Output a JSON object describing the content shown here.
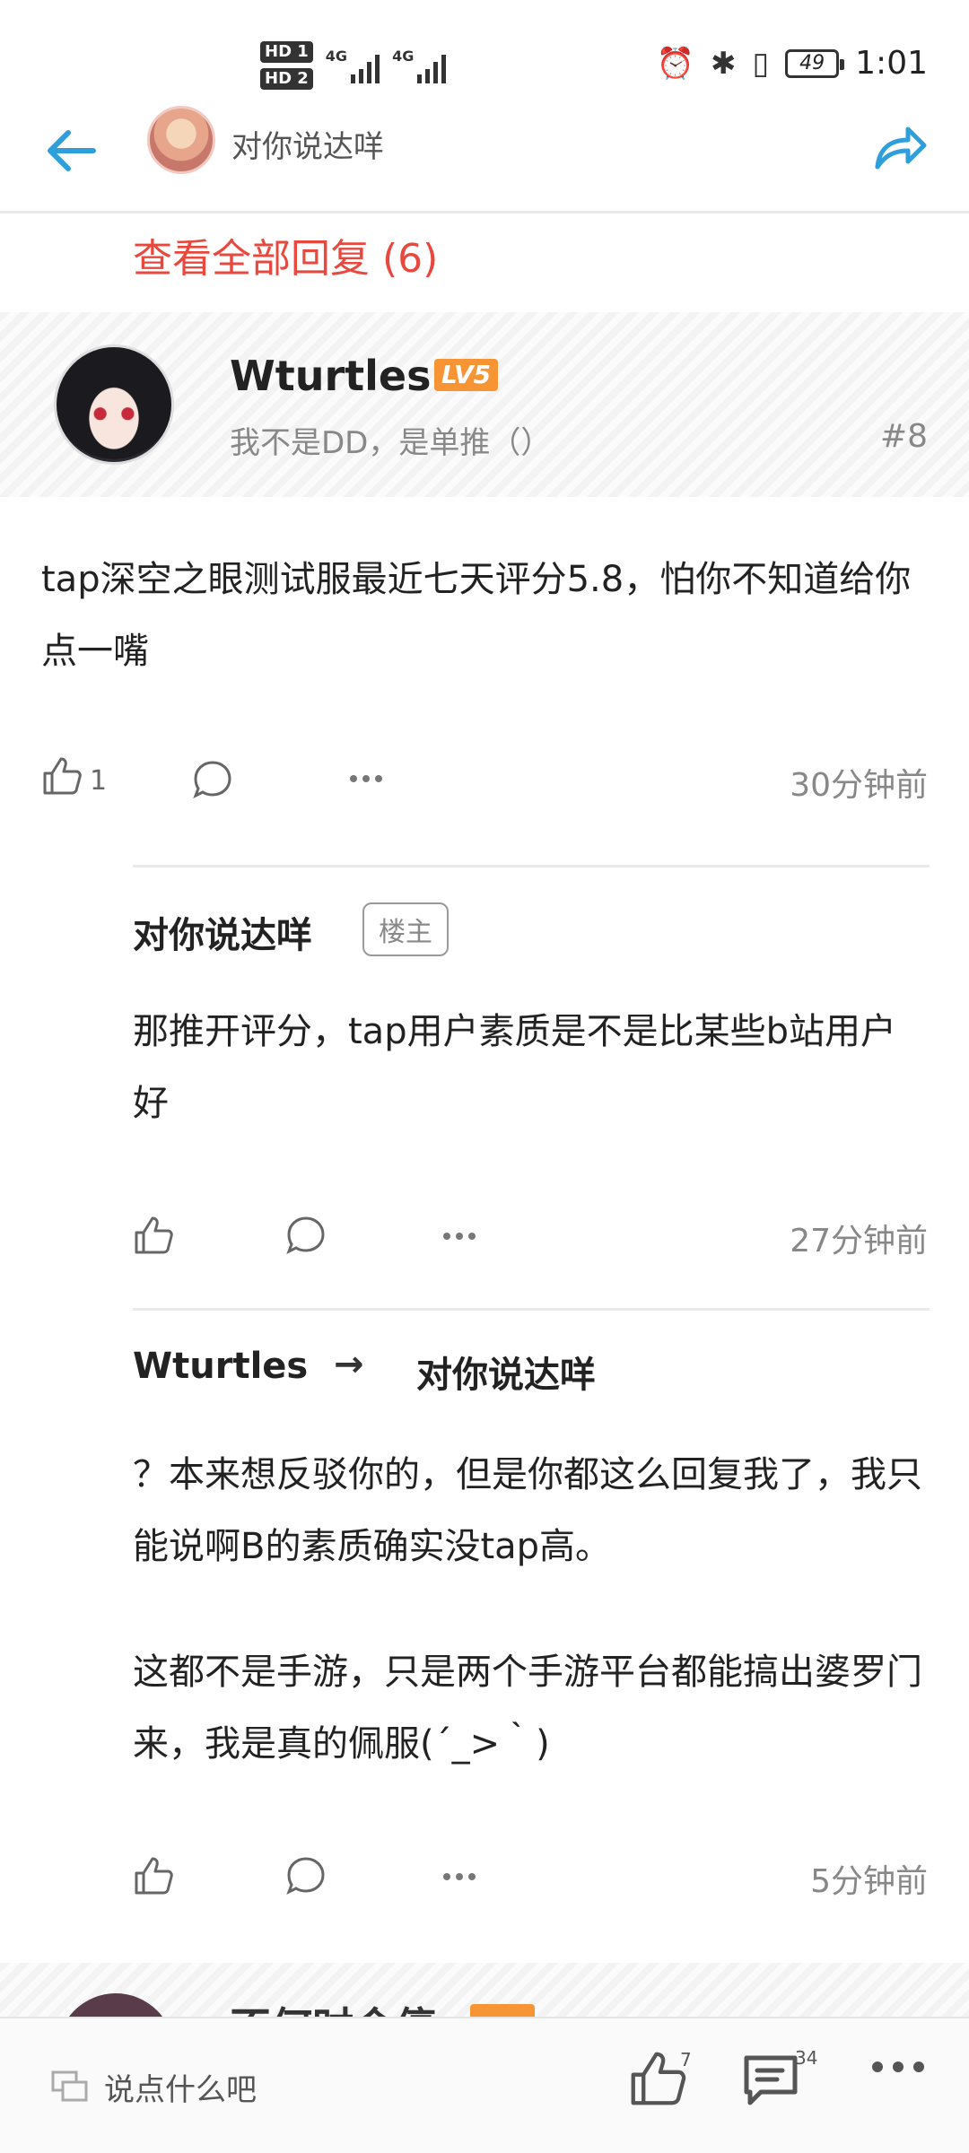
{
  "status_bar": {
    "hd1": "HD 1",
    "hd2": "HD 2",
    "net1": "4G",
    "net2": "4G",
    "battery": "49",
    "time": "1:01",
    "icons": [
      "alarm-icon",
      "bluetooth-icon",
      "vibrate-icon",
      "battery-icon"
    ]
  },
  "header": {
    "title": "对你说达咩",
    "back_icon": "arrow-left-icon",
    "share_icon": "share-arrow-icon",
    "accent": "#2f9fdc"
  },
  "view_all": "查看全部回复 (6)",
  "op": {
    "name": "Wturtles",
    "level": "LV5",
    "signature": "我不是DD，是单推（）",
    "floor": "#8",
    "text": "tap深空之眼测试服最近七天评分5.8，怕你不知道给你点一嘴",
    "likes": "1",
    "time": "30分钟前"
  },
  "replies": [
    {
      "name": "对你说达咩",
      "tag": "楼主",
      "text": "那推开评分，tap用户素质是不是比某些b站用户好",
      "time": "27分钟前"
    },
    {
      "name": "Wturtles",
      "arrow": "→",
      "target": "对你说达咩",
      "text1": "？本来想反驳你的，但是你都这么回复我了，我只能说啊B的素质确实没tap高。",
      "text2": "这都不是手游，只是两个手游平台都能搞出婆罗门来，我是真的佩服(´_>｀)",
      "time": "5分钟前"
    }
  ],
  "next_comment": {
    "name": "不何时会停"
  },
  "bottom_bar": {
    "placeholder": "说点什么吧",
    "like_count": "7",
    "comment_count": "34"
  },
  "colors": {
    "accent_red": "#e8483e",
    "level_orange": "#f79433",
    "icon_grey": "#555555"
  }
}
